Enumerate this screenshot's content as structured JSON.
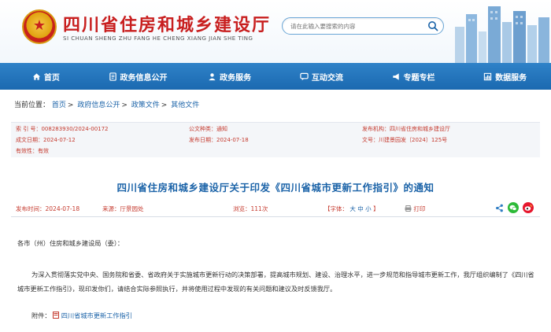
{
  "header": {
    "title": "四川省住房和城乡建设厅",
    "subtitle": "SI CHUAN SHENG ZHU FANG HE CHENG XIANG JIAN SHE TING",
    "search_placeholder": "请在此输入要搜索的内容"
  },
  "nav": {
    "items": [
      {
        "label": "首页",
        "icon": "home-icon"
      },
      {
        "label": "政务信息公开",
        "icon": "document-icon"
      },
      {
        "label": "政务服务",
        "icon": "person-icon"
      },
      {
        "label": "互动交流",
        "icon": "chat-icon"
      },
      {
        "label": "专题专栏",
        "icon": "megaphone-icon"
      },
      {
        "label": "数据服务",
        "icon": "chart-icon"
      }
    ]
  },
  "breadcrumb": {
    "prefix": "当前位置：",
    "items": [
      "首页",
      "政府信息公开",
      "政策文件",
      "其他文件"
    ]
  },
  "meta": {
    "index_no_key": "索 引 号：",
    "index_no": "008283930/2024-00172",
    "category_key": "公文种类：",
    "category": "通知",
    "issuer_key": "发布机构：",
    "issuer": "四川省住房和城乡建设厅",
    "created_key": "成文日期：",
    "created": "2024-07-12",
    "published_key": "发布日期：",
    "published": "2024-07-18",
    "doc_no_key": "文号：",
    "doc_no": "川建景园发〔2024〕125号",
    "validity_key": "有效性：",
    "validity": "有效"
  },
  "doc": {
    "title": "四川省住房和城乡建设厅关于印发《四川省城市更新工作指引》的通知"
  },
  "info_bar": {
    "publish_time": "发布时间：2024-07-18",
    "source": "来源：厅景园处",
    "views": "浏览：111次",
    "font_label": "【字体：",
    "font_large": "大",
    "font_medium": "中",
    "font_small": "小",
    "font_close": "】",
    "print": "打印"
  },
  "body": {
    "salutation": "各市（州）住房和城乡建设局（委）：",
    "paragraph": "为深入贯彻落实党中央、国务院和省委、省政府关于实施城市更新行动的决策部署，提高城市规划、建设、治理水平，进一步规范和指导城市更新工作，我厅组织编制了《四川省城市更新工作指引》，现印发你们，请结合实际参照执行，并将使用过程中发现的有关问题和建议及时反馈我厅。",
    "attachment_label": "附件：",
    "attachment_link": "四川省城市更新工作指引"
  },
  "colors": {
    "nav_blue": "#1b69b0",
    "title_red": "#c81f1f",
    "link_blue": "#1b63a8",
    "meta_red": "#c53a2e"
  }
}
